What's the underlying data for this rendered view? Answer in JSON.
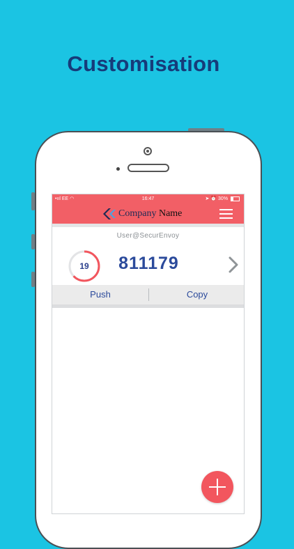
{
  "headline": "Customisation",
  "status_bar": {
    "carrier": "EE",
    "time": "16:47",
    "battery": "30%"
  },
  "app_bar": {
    "company_word1": "Company",
    "company_word2": "Name"
  },
  "token": {
    "user": "User@SecurEnvoy",
    "seconds_remaining": "19",
    "timer_fraction": 0.63,
    "code": "811179"
  },
  "actions": {
    "push_label": "Push",
    "copy_label": "Copy"
  },
  "colors": {
    "background": "#1bc4e3",
    "accent": "#f25f66",
    "code_text": "#2b4a9b"
  },
  "icons": [
    "signal-icon",
    "wifi-icon",
    "location-icon",
    "alarm-icon",
    "battery-icon",
    "logo-icon",
    "hamburger-menu-icon",
    "chevron-right-icon",
    "add-icon"
  ]
}
